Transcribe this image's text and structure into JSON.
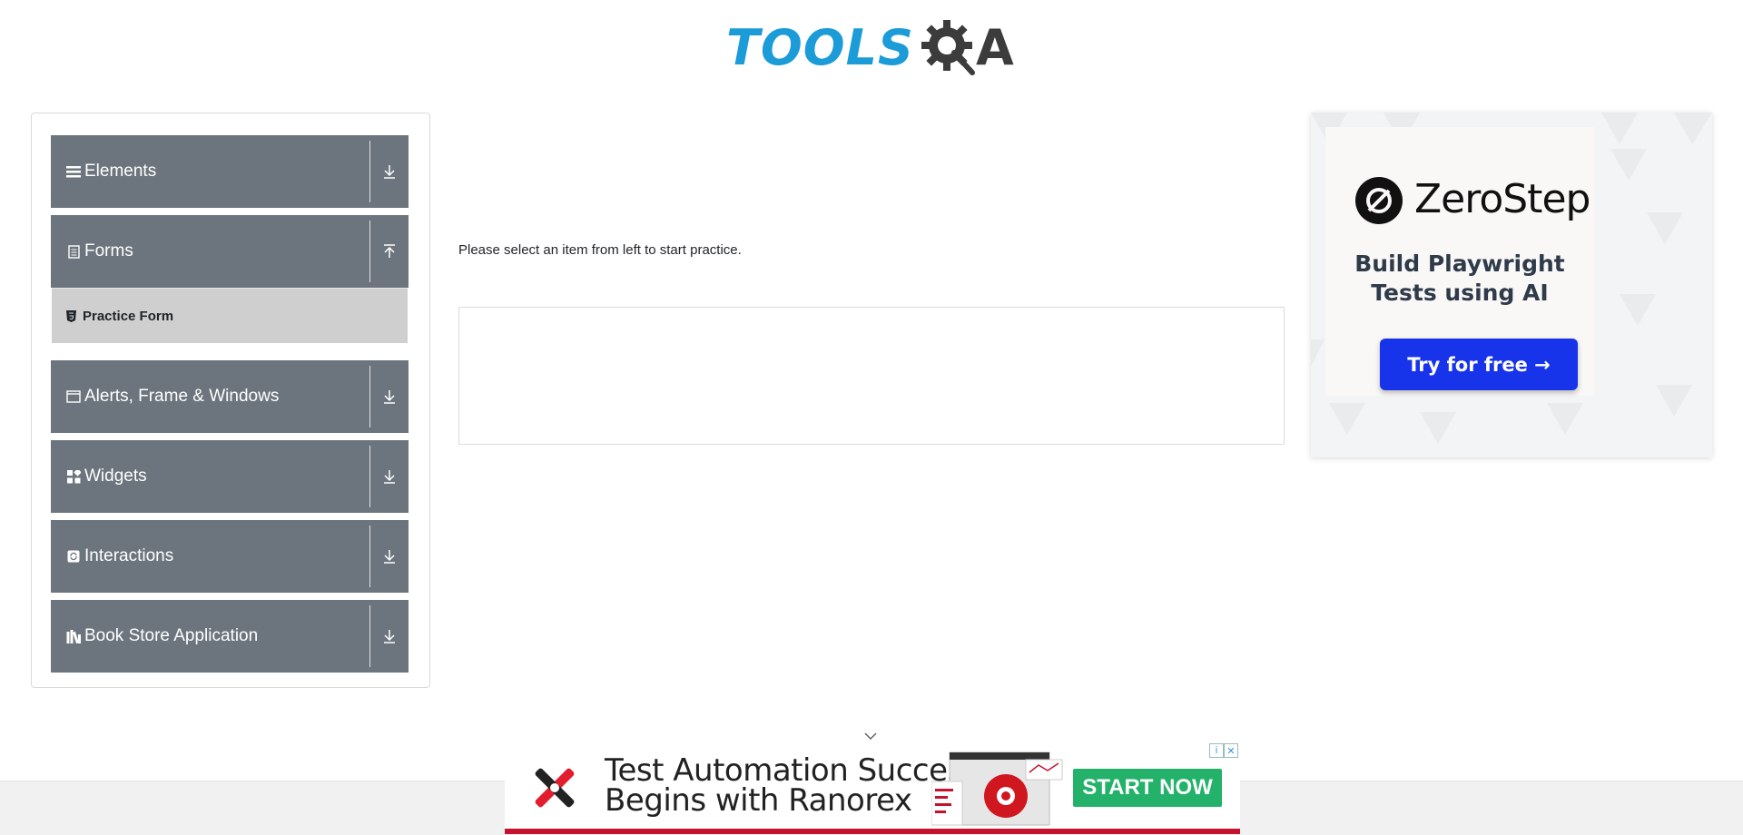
{
  "header": {
    "logo_text_left": "TOOLS",
    "logo_text_right": "A",
    "logo_colors": {
      "blue": "#1b9bd7",
      "dark": "#3c3c3c"
    }
  },
  "sidebar": {
    "groups": [
      {
        "label": "Elements",
        "icon": "hamburger-icon",
        "arrow": "download-icon"
      },
      {
        "label": "Forms",
        "icon": "document-icon",
        "arrow": "upload-icon",
        "expanded": true,
        "items": [
          {
            "label": "Practice Form",
            "icon": "html5-icon"
          }
        ]
      },
      {
        "label": "Alerts, Frame & Windows",
        "icon": "window-icon",
        "arrow": "download-icon"
      },
      {
        "label": "Widgets",
        "icon": "widgets-icon",
        "arrow": "download-icon"
      },
      {
        "label": "Interactions",
        "icon": "interactions-icon",
        "arrow": "download-icon"
      },
      {
        "label": "Book Store Application",
        "icon": "books-icon",
        "arrow": "download-icon"
      }
    ],
    "header_color": "#6c757d",
    "active_item_color": "#cfcfcf"
  },
  "main": {
    "message": "Please select an item from left to start practice."
  },
  "ad_right": {
    "brand": "ZeroStep",
    "subtitle_line1": "Build Playwright",
    "subtitle_line2": "Tests using AI",
    "button": "Try for free →",
    "button_color": "#1834ea"
  },
  "ad_bottom": {
    "line1": "Test Automation Success",
    "line2": "Begins with Ranorex",
    "button": "START NOW",
    "button_color": "#24b26a",
    "accent_color": "#c4122f"
  }
}
